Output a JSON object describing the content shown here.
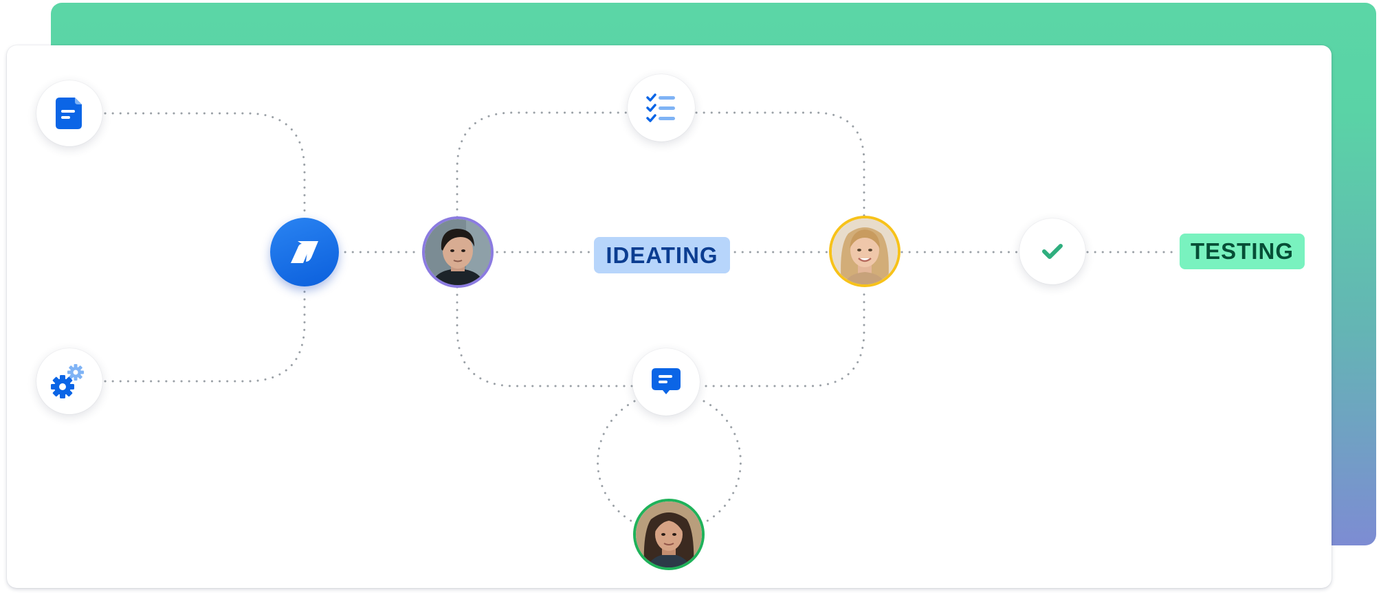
{
  "labels": {
    "ideating": "IDEATING",
    "testing": "TESTING"
  },
  "icons": {
    "document": "document-icon",
    "settings": "gears-icon",
    "checklist": "checklist-icon",
    "comment": "comment-icon",
    "check": "checkmark-icon",
    "hub": "brand-logo-icon"
  },
  "colors": {
    "brand_blue": "#0b65e6",
    "light_blue": "#7fb3f5",
    "ideating_bg": "#b7d5fb",
    "ideating_text": "#0b3d91",
    "testing_bg": "#79f2bf",
    "testing_text": "#064e36",
    "check_green": "#2fae7e",
    "ring_purple": "#8b7be0",
    "ring_yellow": "#f7c21a",
    "ring_green": "#1fb25a",
    "connector": "#9aa0a6",
    "back_card_top": "#5bd6a6",
    "back_card_bottom": "#7d8cd3"
  }
}
